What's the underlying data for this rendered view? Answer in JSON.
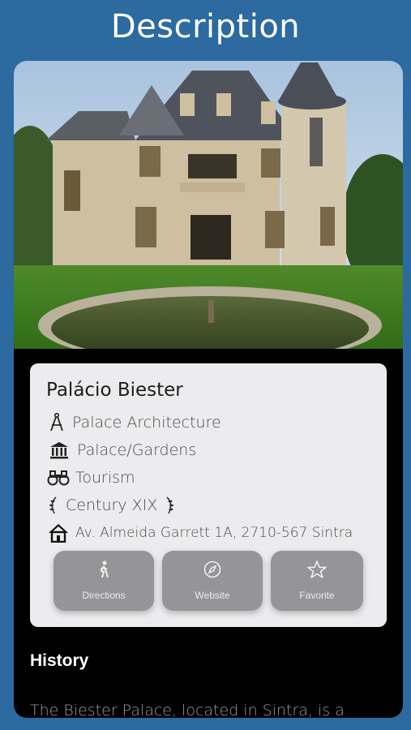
{
  "header": {
    "title": "Description"
  },
  "place": {
    "name": "Palácio Biester",
    "architecture": "Palace Architecture",
    "category": "Palace/Gardens",
    "activity": "Tourism",
    "century": "Century XIX",
    "address": "Av. Almeida Garrett 1A, 2710-567 Sintra"
  },
  "actions": {
    "directions": "Directions",
    "website": "Website",
    "favorite": "Favorite"
  },
  "history": {
    "title": "History",
    "text": "The Biester Palace, located in Sintra, is a"
  },
  "icons": {
    "architecture": "compass-drafting-icon",
    "category": "bank-building-icon",
    "activity": "binoculars-icon",
    "century": "laurel-wreath-icon",
    "address": "house-icon",
    "directions": "walking-person-icon",
    "website": "compass-icon",
    "favorite": "star-icon"
  },
  "colors": {
    "background": "#2c6aa0",
    "panel": "#000000",
    "card": "#ececee",
    "button": "#959598"
  }
}
